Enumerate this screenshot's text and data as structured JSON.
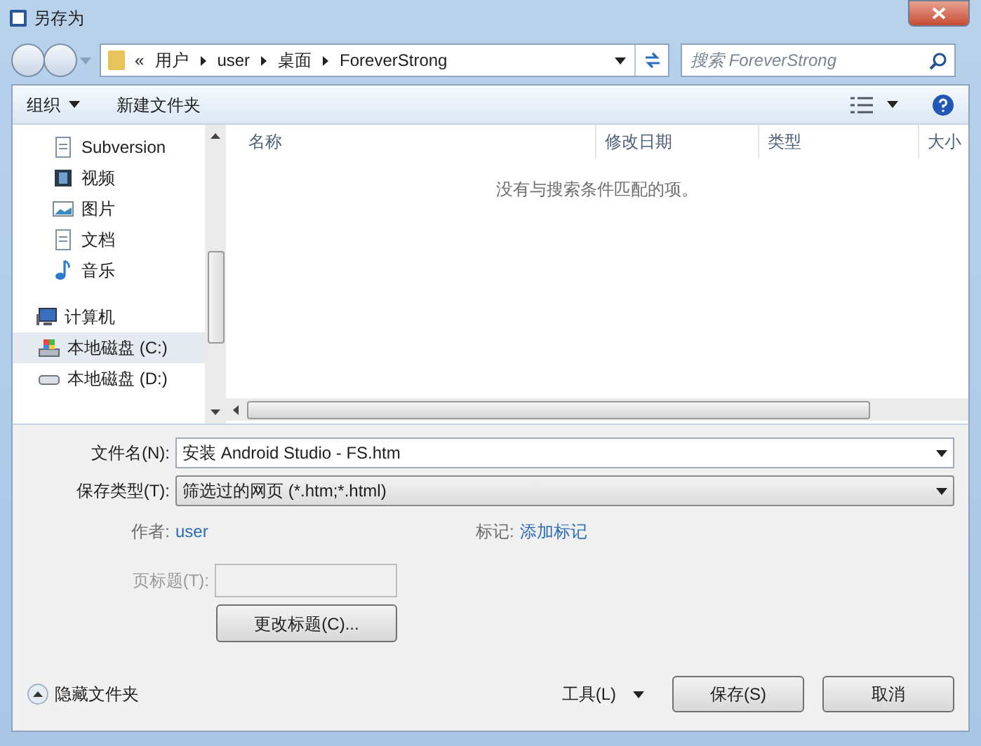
{
  "window": {
    "title": "另存为"
  },
  "address": {
    "prefix": "«",
    "crumbs": [
      "用户",
      "user",
      "桌面",
      "ForeverStrong"
    ]
  },
  "search": {
    "placeholder": "搜索 ForeverStrong"
  },
  "toolbar": {
    "buttons": [
      {
        "label": "组织",
        "dropdown": true
      },
      {
        "label": "新建文件夹",
        "dropdown": false
      }
    ]
  },
  "sidebar": {
    "items": [
      {
        "label": "Subversion",
        "kind": "document",
        "selected": false
      },
      {
        "label": "视频",
        "kind": "video",
        "selected": false
      },
      {
        "label": "图片",
        "kind": "picture",
        "selected": false
      },
      {
        "label": "文档",
        "kind": "document",
        "selected": false
      },
      {
        "label": "音乐",
        "kind": "music",
        "selected": false
      },
      {
        "label": "计算机",
        "kind": "computer",
        "selected": false,
        "children": [
          {
            "label": "本地磁盘 (C:)",
            "kind": "system-drive",
            "selected": true
          },
          {
            "label": "本地磁盘 (D:)",
            "kind": "drive",
            "selected": false
          }
        ]
      }
    ]
  },
  "file_list": {
    "columns": [
      "名称",
      "修改日期",
      "类型",
      "大小"
    ],
    "empty_message": "没有与搜索条件匹配的项。"
  },
  "form": {
    "file_name": {
      "label": "文件名(N):",
      "value": "安装 Android Studio - FS.htm"
    },
    "save_type": {
      "label": "保存类型(T):",
      "value": "筛选过的网页 (*.htm;*.html)"
    },
    "author": {
      "label": "作者:",
      "value": "user"
    },
    "tags": {
      "label": "标记:",
      "value": "添加标记"
    },
    "page_title": {
      "label": "页标题(T):"
    },
    "change_title_button": "更改标题(C)..."
  },
  "footer": {
    "hide_folders": "隐藏文件夹",
    "tools": "工具(L)",
    "buttons": [
      "保存(S)",
      "取消"
    ]
  }
}
